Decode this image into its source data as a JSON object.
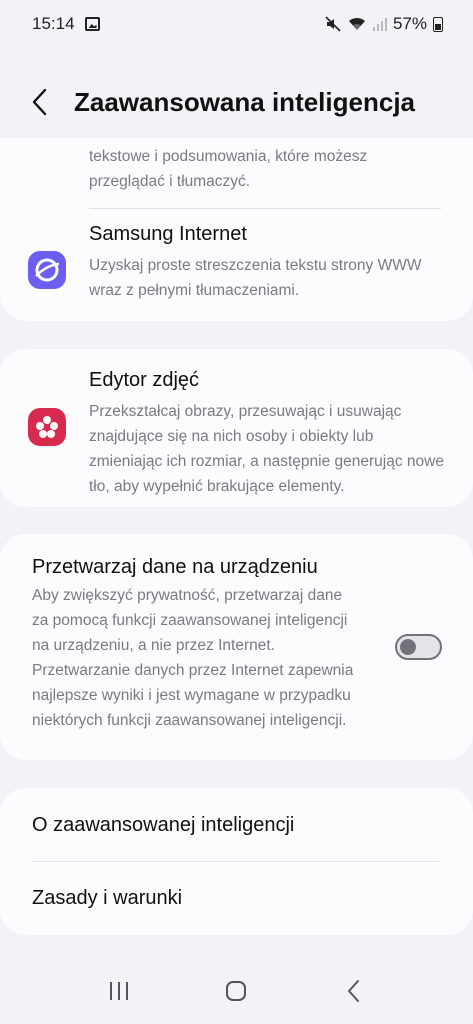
{
  "status_bar": {
    "time": "15:14",
    "battery": "57%"
  },
  "header": {
    "title": "Zaawansowana inteligencja"
  },
  "card_apps": {
    "partial_desc": "tekstowe i podsumowania, które możesz przeglądać i tłumaczyć.",
    "samsung_internet": {
      "title": "Samsung Internet",
      "desc": "Uzyskaj proste streszczenia tekstu strony WWW wraz z pełnymi tłumaczeniami."
    }
  },
  "card_photo": {
    "title": "Edytor zdjęć",
    "desc": "Przekształcaj obrazy, przesuwając i usuwając znajdujące się na nich osoby i obiekty lub zmieniając ich rozmiar, a następnie generując nowe tło, aby wypełnić brakujące elementy."
  },
  "card_process": {
    "title": "Przetwarzaj dane na urządzeniu",
    "desc": "Aby zwiększyć prywatność, przetwarzaj dane za pomocą funkcji zaawansowanej inteligencji na urządzeniu, a nie przez Internet. Przetwarzanie danych przez Internet zapewnia najlepsze wyniki i jest wymagane w przypadku niektórych funkcji zaawansowanej inteligencji.",
    "toggle_on": false
  },
  "card_links": {
    "about": "O zaawansowanej inteligencji",
    "terms": "Zasady i warunki"
  },
  "colors": {
    "background": "#f2f2f7",
    "card": "#fcfcfe",
    "internet_icon": "#6a5ff0",
    "photo_icon": "#d8294f",
    "partial_icon": "#e0452f"
  },
  "icons": {
    "mute": "mute-icon",
    "wifi": "wifi-icon",
    "signal": "signal-icon",
    "gallery": "gallery-icon"
  }
}
